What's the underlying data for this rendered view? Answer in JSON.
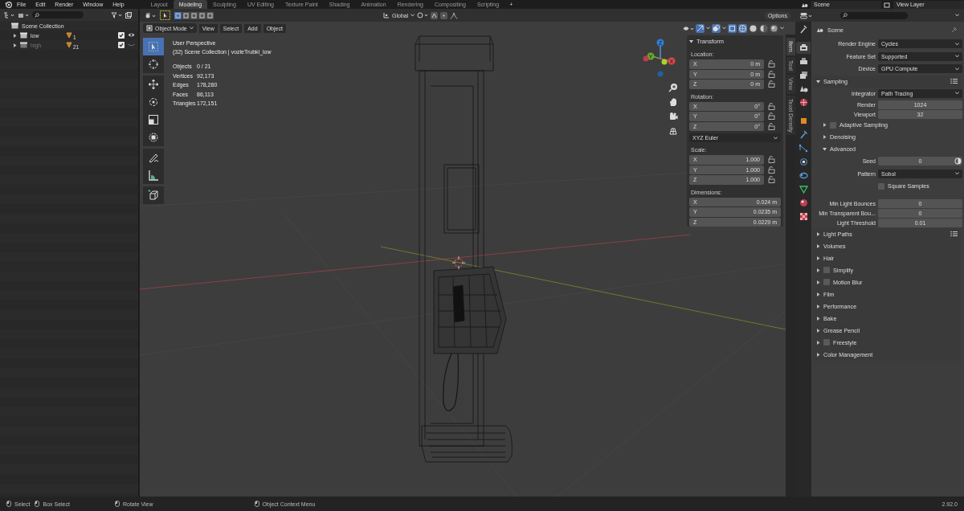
{
  "topbar": {
    "menus": [
      "File",
      "Edit",
      "Render",
      "Window",
      "Help"
    ],
    "workspaces": [
      {
        "label": "Layout",
        "selected": false
      },
      {
        "label": "Modeling",
        "selected": true
      },
      {
        "label": "Sculpting",
        "selected": false
      },
      {
        "label": "UV Editing",
        "selected": false
      },
      {
        "label": "Texture Paint",
        "selected": false
      },
      {
        "label": "Shading",
        "selected": false
      },
      {
        "label": "Animation",
        "selected": false
      },
      {
        "label": "Rendering",
        "selected": false
      },
      {
        "label": "Compositing",
        "selected": false
      },
      {
        "label": "Scripting",
        "selected": false
      }
    ],
    "add_workspace": "+",
    "scene": "Scene",
    "view_layer": "View Layer"
  },
  "outliner": {
    "root": "Scene Collection",
    "items": [
      {
        "name": "low",
        "count": "1",
        "expanded": false,
        "checked": true,
        "visible": true,
        "disabled": false
      },
      {
        "name": "high",
        "count": "21",
        "expanded": false,
        "checked": true,
        "visible": false,
        "disabled": true
      }
    ]
  },
  "viewport": {
    "orientation": "Global",
    "options": "Options",
    "mode": "Object Mode",
    "menus": [
      "View",
      "Select",
      "Add",
      "Object"
    ],
    "tools": [
      {
        "selected": true
      },
      {
        "selected": false
      },
      {
        "selected": false
      },
      {
        "selected": false
      },
      {
        "selected": false
      },
      {
        "selected": false
      },
      {
        "selected": false
      },
      {
        "selected": false
      },
      {
        "selected": false
      }
    ],
    "shading": [
      {
        "selected": true
      },
      {
        "selected": false
      },
      {
        "selected": false
      },
      {
        "selected": false
      }
    ],
    "overlay": {
      "title": "User Perspective",
      "subtitle": "(32) Scene Collection | vozleTrubki_low",
      "stats": [
        {
          "label": "Objects",
          "value": "0 / 21"
        },
        {
          "label": "Vertices",
          "value": "92,173"
        },
        {
          "label": "Edges",
          "value": "178,280"
        },
        {
          "label": "Faces",
          "value": "86,113"
        },
        {
          "label": "Triangles",
          "value": "172,151"
        }
      ]
    },
    "gizmo": {
      "x": "X",
      "y": "Y",
      "z": "Z"
    },
    "sidebar_tabs": [
      {
        "label": "Item",
        "selected": true
      },
      {
        "label": "Tool",
        "selected": false
      },
      {
        "label": "View",
        "selected": false
      },
      {
        "label": "Texel Density",
        "selected": false
      }
    ],
    "transform": {
      "title": "Transform",
      "expanded": true,
      "rotation_mode": "XYZ Euler",
      "groups": [
        {
          "label": "Location:",
          "fields": [
            {
              "axis": "X",
              "value": "0 m",
              "locked": false
            },
            {
              "axis": "Y",
              "value": "0 m",
              "locked": false
            },
            {
              "axis": "Z",
              "value": "0 m",
              "locked": false
            }
          ]
        },
        {
          "label": "Rotation:",
          "fields": [
            {
              "axis": "X",
              "value": "0°",
              "locked": false
            },
            {
              "axis": "Y",
              "value": "0°",
              "locked": false
            },
            {
              "axis": "Z",
              "value": "0°",
              "locked": false
            }
          ]
        },
        {
          "label": "Scale:",
          "fields": [
            {
              "axis": "X",
              "value": "1.000",
              "locked": false
            },
            {
              "axis": "Y",
              "value": "1.000",
              "locked": false
            },
            {
              "axis": "Z",
              "value": "1.000",
              "locked": false
            }
          ]
        },
        {
          "label": "Dimensions:",
          "fields": [
            {
              "axis": "X",
              "value": "0.024 m"
            },
            {
              "axis": "Y",
              "value": "0.0235 m"
            },
            {
              "axis": "Z",
              "value": "0.0229 m"
            }
          ]
        }
      ]
    }
  },
  "properties": {
    "context": "Scene",
    "tabs": [
      {
        "selected": false
      },
      {
        "selected": true
      },
      {
        "selected": false
      },
      {
        "selected": false
      },
      {
        "selected": false
      },
      {
        "selected": false
      },
      {
        "selected": false
      },
      {
        "selected": false
      },
      {
        "selected": false
      },
      {
        "selected": false
      },
      {
        "selected": false
      },
      {
        "selected": false
      },
      {
        "selected": false
      },
      {
        "selected": false
      }
    ],
    "rows": [
      {
        "kind": "select",
        "label": "Render Engine",
        "value": "Cycles"
      },
      {
        "kind": "select",
        "label": "Feature Set",
        "value": "Supported"
      },
      {
        "kind": "select",
        "label": "Device",
        "value": "GPU Compute"
      },
      {
        "kind": "panel",
        "label": "Sampling",
        "expanded": true,
        "presets": true
      },
      {
        "kind": "select",
        "label": "Integrator",
        "value": "Path Tracing"
      },
      {
        "kind": "number",
        "label": "Render",
        "value": "1024"
      },
      {
        "kind": "number",
        "label": "Viewport",
        "value": "32"
      },
      {
        "kind": "subpanel",
        "label": "Adaptive Sampling",
        "expanded": false,
        "checked": false
      },
      {
        "kind": "subpanel",
        "label": "Denoising",
        "expanded": false
      },
      {
        "kind": "subpanel",
        "label": "Advanced",
        "expanded": true
      },
      {
        "kind": "seed",
        "label": "Seed",
        "value": "0"
      },
      {
        "kind": "select",
        "label": "Pattern",
        "value": "Sobol"
      },
      {
        "kind": "checkbox",
        "label": "Square Samples",
        "checked": false
      },
      {
        "kind": "number",
        "label": "Min Light Bounces",
        "value": "0"
      },
      {
        "kind": "number",
        "label": "Min Transparent Bou...",
        "value": "0"
      },
      {
        "kind": "number",
        "label": "Light Threshold",
        "value": "0.01"
      },
      {
        "kind": "panel",
        "label": "Light Paths",
        "expanded": false,
        "presets": true
      },
      {
        "kind": "panel",
        "label": "Volumes",
        "expanded": false
      },
      {
        "kind": "panel",
        "label": "Hair",
        "expanded": false
      },
      {
        "kind": "panel",
        "label": "Simplify",
        "expanded": false,
        "checked": false
      },
      {
        "kind": "panel",
        "label": "Motion Blur",
        "expanded": false,
        "checked": false
      },
      {
        "kind": "panel",
        "label": "Film",
        "expanded": false
      },
      {
        "kind": "panel",
        "label": "Performance",
        "expanded": false
      },
      {
        "kind": "panel",
        "label": "Bake",
        "expanded": false
      },
      {
        "kind": "panel",
        "label": "Grease Pencil",
        "expanded": false
      },
      {
        "kind": "panel",
        "label": "Freestyle",
        "expanded": false,
        "checked": false
      },
      {
        "kind": "panel",
        "label": "Color Management",
        "expanded": false
      }
    ]
  },
  "status_bar": {
    "items": [
      {
        "label": "Select"
      },
      {
        "label": "Box Select"
      },
      {
        "label": "Rotate View"
      },
      {
        "label": "Object Context Menu"
      }
    ],
    "version": "2.92.0"
  }
}
